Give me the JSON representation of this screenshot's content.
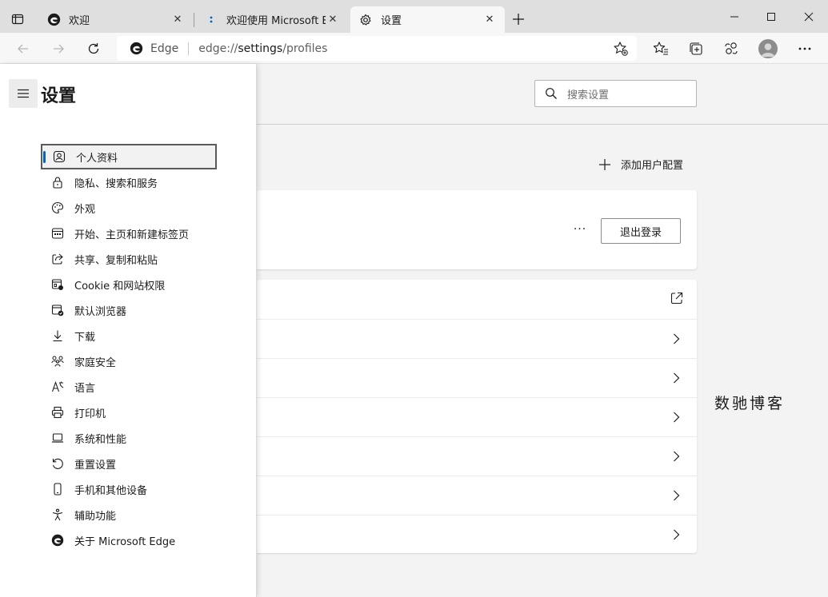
{
  "tabs": [
    {
      "title": "欢迎",
      "close": "✕"
    },
    {
      "title": "欢迎使用 Microsoft Edge",
      "close": "✕"
    },
    {
      "title": "设置",
      "close": "✕"
    }
  ],
  "address": {
    "site": "Edge",
    "url_prefix": "edge://",
    "url_host": "settings",
    "url_path": "/profiles"
  },
  "header": {
    "title": "设置",
    "search_placeholder": "搜索设置"
  },
  "sidebar": {
    "items": [
      {
        "label": "个人资料",
        "icon": "profile-icon",
        "active": true
      },
      {
        "label": "隐私、搜索和服务",
        "icon": "lock-icon"
      },
      {
        "label": "外观",
        "icon": "palette-icon"
      },
      {
        "label": "开始、主页和新建标签页",
        "icon": "home-tabs-icon"
      },
      {
        "label": "共享、复制和粘贴",
        "icon": "share-icon"
      },
      {
        "label": "Cookie 和网站权限",
        "icon": "site-permissions-icon"
      },
      {
        "label": "默认浏览器",
        "icon": "default-browser-icon"
      },
      {
        "label": "下载",
        "icon": "download-icon"
      },
      {
        "label": "家庭安全",
        "icon": "family-icon"
      },
      {
        "label": "语言",
        "icon": "language-icon"
      },
      {
        "label": "打印机",
        "icon": "printer-icon"
      },
      {
        "label": "系统和性能",
        "icon": "laptop-icon"
      },
      {
        "label": "重置设置",
        "icon": "reset-icon"
      },
      {
        "label": "手机和其他设备",
        "icon": "phone-icon"
      },
      {
        "label": "辅助功能",
        "icon": "accessibility-icon"
      },
      {
        "label": "关于 Microsoft Edge",
        "icon": "edge-logo-icon"
      }
    ]
  },
  "main": {
    "add_profile_label": "添加用户配置",
    "more_label": "···",
    "signout_label": "退出登录"
  },
  "watermark": "数驰博客",
  "colors": {
    "accent": "#0067c0",
    "tabbar": "#dfdfdf",
    "content_bg": "#f3f3f3"
  }
}
